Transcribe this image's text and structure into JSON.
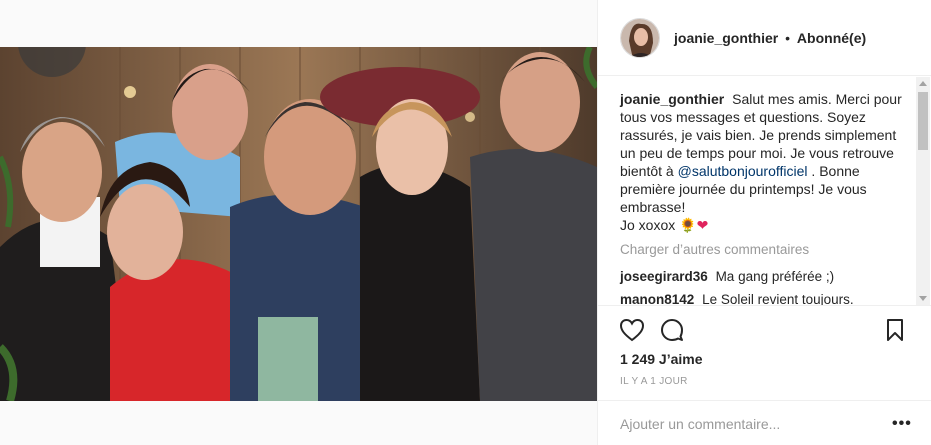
{
  "post": {
    "image_alt": "Group photo of six people smiling"
  },
  "header": {
    "username": "joanie_gonthier",
    "separator": "•",
    "follow_state": "Abonné(e)"
  },
  "caption": {
    "username": "joanie_gonthier",
    "text_before_mention": "Salut mes amis. Merci pour tous vos messages et questions. Soyez rassurés, je vais bien. Je prends simplement un peu de temps pour moi. Je vous retrouve bientôt à",
    "mention": "@salutbonjourofficiel",
    "text_after_mention": ". Bonne première journée du printemps! Je vous embrasse!",
    "signoff": "Jo xoxox",
    "emoji_flower": "🌻",
    "emoji_heart": "❤"
  },
  "load_more": "Charger d’autres commentaires",
  "comments": [
    {
      "username": "joseegirard36",
      "text": "Ma gang préférée ;)"
    },
    {
      "username": "manon8142",
      "text": "Le Soleil revient toujours."
    }
  ],
  "actions": {
    "icons": [
      "heart-icon",
      "comment-bubble-icon",
      "bookmark-icon"
    ]
  },
  "likes": "1 249 J’aime",
  "timestamp": "IL Y A 1 JOUR",
  "add_comment": {
    "placeholder": "Ajouter un commentaire...",
    "more_label": "•••"
  }
}
